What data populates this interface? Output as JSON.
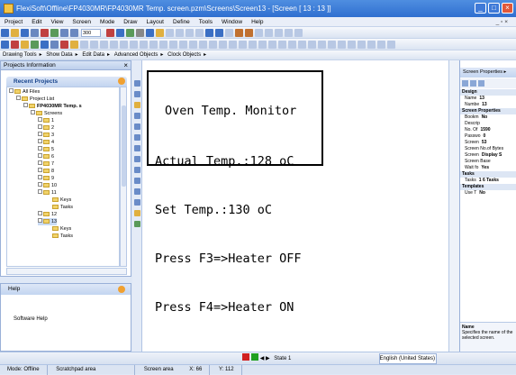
{
  "window": {
    "title": "FlexiSoft\\Offline\\FP4030MR\\FP4030MR Temp. screen.pzm\\Screens\\Screen13 - [Screen [ 13 : 13 ]]"
  },
  "menu": [
    "Project",
    "Edit",
    "View",
    "Screen",
    "Mode",
    "Draw",
    "Layout",
    "Define",
    "Tools",
    "Window",
    "Help"
  ],
  "toolbar": {
    "zoom": "300"
  },
  "toolbar3": {
    "drawing_tools": "Drawing Tools",
    "show_data": "Show Data",
    "edit_data": "Edit Data",
    "advanced_objects": "Advanced Objects",
    "clock_objects": "Clock Objects"
  },
  "projects_panel": {
    "title": "Projects Information",
    "recent_title": "Recent Projects",
    "tree": {
      "all_files": "All Files",
      "project_list": "Project List",
      "project": "FP4030MR Temp. s",
      "screens": "Screens",
      "screen_items": [
        "1",
        "2",
        "3",
        "4",
        "5",
        "6",
        "7",
        "8",
        "9",
        "10",
        "11"
      ],
      "sub_11": [
        "Keys",
        "Tasks"
      ],
      "screen_12": "12",
      "screen_13": "13",
      "sub_13": [
        "Keys",
        "Tasks"
      ]
    }
  },
  "help_panel": {
    "title": "Help",
    "body": "Software Help"
  },
  "screen": {
    "lines": [
      "Oven Temp. Monitor",
      "Actual Temp.:128 oC",
      "Set Temp.:130 oC",
      "Press F3=>Heater OFF",
      "Press F4=>Heater ON"
    ]
  },
  "properties": {
    "tab": "Screen Properties",
    "rows": [
      {
        "cat": true,
        "label": "Design"
      },
      {
        "label": "Name",
        "value": "13"
      },
      {
        "label": "Numbe",
        "value": "13"
      },
      {
        "cat": true,
        "label": "Screen Properties"
      },
      {
        "label": "Bookm",
        "value": "No"
      },
      {
        "label": "Descrip",
        "value": ""
      },
      {
        "label": "No. Of",
        "value": "1590"
      },
      {
        "label": "Passwo",
        "value": "0"
      },
      {
        "label": "Screen",
        "value": "53"
      },
      {
        "label": "Screen No.of Bytes",
        "value": ""
      },
      {
        "label": "Screen",
        "value": "Display S"
      },
      {
        "label": "Screen Base",
        "value": ""
      },
      {
        "label": "Wait fo",
        "value": "Yes"
      },
      {
        "cat": true,
        "label": "Tasks"
      },
      {
        "label": "Tasks",
        "value": "1 6 Tasks"
      },
      {
        "cat": true,
        "label": "Templates"
      },
      {
        "label": "Use T",
        "value": "No"
      }
    ],
    "desc_title": "Name",
    "desc_text": "Specifies the name of the selected screen."
  },
  "bottombar": {
    "state": "State 1",
    "language": "English (United States)"
  },
  "statusbar": {
    "mode": "Mode: Offline",
    "scratchpad": "Scratchpad area",
    "screen_area": "Screen area",
    "x": "X: 66",
    "y": "Y: 112"
  }
}
